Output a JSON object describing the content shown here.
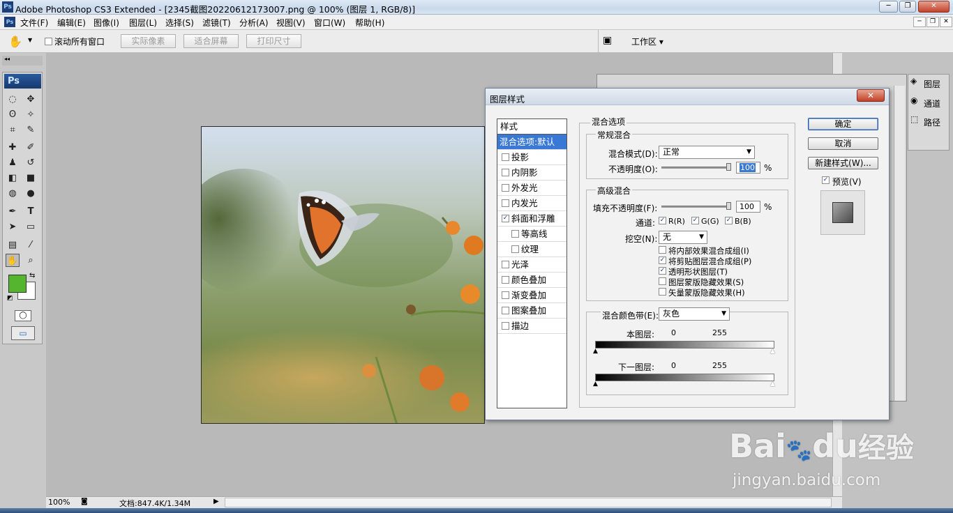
{
  "window": {
    "app_logo": "Ps",
    "title": "Adobe Photoshop CS3 Extended - [2345截图20220612173007.png @ 100% (图层 1, RGB/8)]",
    "controls": [
      "─",
      "❐",
      "✕"
    ]
  },
  "menu": {
    "items": [
      "文件(F)",
      "编辑(E)",
      "图像(I)",
      "图层(L)",
      "选择(S)",
      "滤镜(T)",
      "分析(A)",
      "视图(V)",
      "窗口(W)",
      "帮助(H)"
    ],
    "doc_controls": [
      "─",
      "❐",
      "✕"
    ]
  },
  "options": {
    "scroll_all_label": "滚动所有窗口",
    "buttons": [
      "实际像素",
      "适合屏幕",
      "打印尺寸"
    ],
    "workspace_label": "工作区 ▾"
  },
  "toolbox": {
    "brand": "Ps",
    "foreground_color": "#55b52f",
    "background_color": "#ffffff"
  },
  "status": {
    "zoom": "100%",
    "doc_info": "文档:847.4K/1.34M"
  },
  "dock": {
    "tabs": [
      "图层",
      "通道",
      "路径"
    ]
  },
  "dialog": {
    "title": "图层样式",
    "styles_header": "样式",
    "styles": [
      {
        "label": "混合选项:默认",
        "checkbox": false,
        "checked": false,
        "selected": true,
        "indent": false
      },
      {
        "label": "投影",
        "checkbox": true,
        "checked": false,
        "selected": false,
        "indent": false
      },
      {
        "label": "内阴影",
        "checkbox": true,
        "checked": false,
        "selected": false,
        "indent": false
      },
      {
        "label": "外发光",
        "checkbox": true,
        "checked": false,
        "selected": false,
        "indent": false
      },
      {
        "label": "内发光",
        "checkbox": true,
        "checked": false,
        "selected": false,
        "indent": false
      },
      {
        "label": "斜面和浮雕",
        "checkbox": true,
        "checked": true,
        "selected": false,
        "indent": false
      },
      {
        "label": "等高线",
        "checkbox": true,
        "checked": false,
        "selected": false,
        "indent": true
      },
      {
        "label": "纹理",
        "checkbox": true,
        "checked": false,
        "selected": false,
        "indent": true
      },
      {
        "label": "光泽",
        "checkbox": true,
        "checked": false,
        "selected": false,
        "indent": false
      },
      {
        "label": "颜色叠加",
        "checkbox": true,
        "checked": false,
        "selected": false,
        "indent": false
      },
      {
        "label": "渐变叠加",
        "checkbox": true,
        "checked": false,
        "selected": false,
        "indent": false
      },
      {
        "label": "图案叠加",
        "checkbox": true,
        "checked": false,
        "selected": false,
        "indent": false
      },
      {
        "label": "描边",
        "checkbox": true,
        "checked": false,
        "selected": false,
        "indent": false
      }
    ],
    "blend_options_title": "混合选项",
    "general_title": "常规混合",
    "blend_mode_label": "混合模式(D):",
    "blend_mode_value": "正常",
    "opacity_label": "不透明度(O):",
    "opacity_value": "100",
    "percent": "%",
    "advanced_title": "高级混合",
    "fill_opacity_label": "填充不透明度(F):",
    "fill_opacity_value": "100",
    "channels_label": "通道:",
    "channels": [
      {
        "label": "R(R)",
        "checked": true
      },
      {
        "label": "G(G)",
        "checked": true
      },
      {
        "label": "B(B)",
        "checked": true
      }
    ],
    "knockout_label": "挖空(N):",
    "knockout_value": "无",
    "advanced_options": [
      {
        "label": "将内部效果混合成组(I)",
        "checked": false
      },
      {
        "label": "将剪贴图层混合成组(P)",
        "checked": true
      },
      {
        "label": "透明形状图层(T)",
        "checked": true
      },
      {
        "label": "图层蒙版隐藏效果(S)",
        "checked": false
      },
      {
        "label": "矢量蒙版隐藏效果(H)",
        "checked": false
      }
    ],
    "blend_if_label": "混合颜色带(E):",
    "blend_if_value": "灰色",
    "this_layer_label": "本图层:",
    "underlying_label": "下一图层:",
    "range_min": "0",
    "range_max": "255",
    "buttons": {
      "ok": "确定",
      "cancel": "取消",
      "new_style": "新建样式(W)..."
    },
    "preview_label": "预览(V)",
    "preview_checked": true
  },
  "watermark": {
    "brand": "Bai",
    "brand2": "du",
    "cn": "经验",
    "url": "jingyan.baidu.com"
  }
}
